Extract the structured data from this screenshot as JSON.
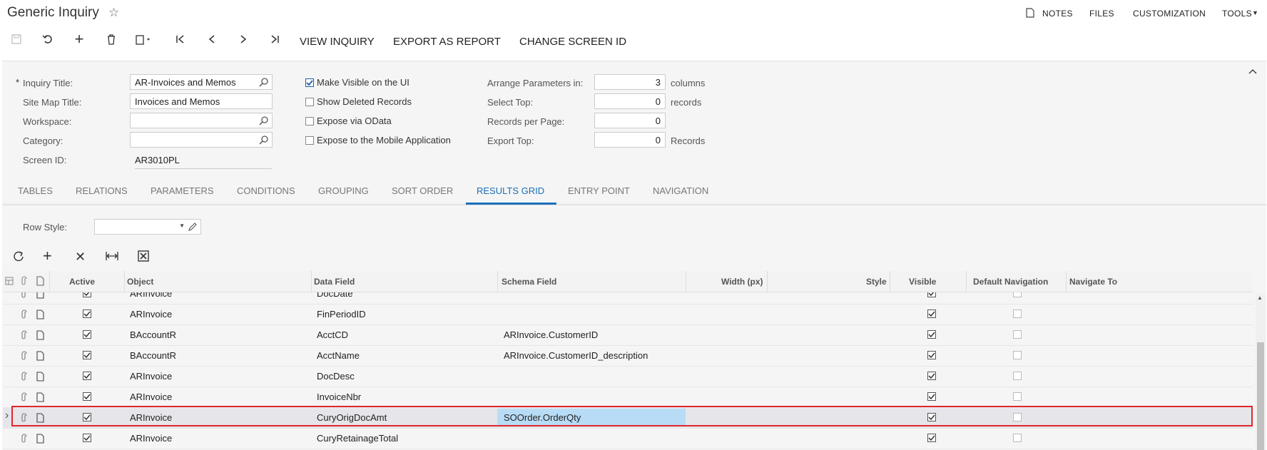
{
  "header": {
    "title": "Generic Inquiry",
    "menu": [
      "NOTES",
      "FILES",
      "CUSTOMIZATION",
      "TOOLS"
    ]
  },
  "toolbar": {
    "view_inquiry": "VIEW INQUIRY",
    "export_as_report": "EXPORT AS REPORT",
    "change_screen_id": "CHANGE SCREEN ID"
  },
  "form": {
    "required_mark": "*",
    "inquiry_title_label": "Inquiry Title:",
    "inquiry_title_value": "AR-Invoices and Memos",
    "site_map_title_label": "Site Map Title:",
    "site_map_title_value": "Invoices and Memos",
    "workspace_label": "Workspace:",
    "workspace_value": "",
    "category_label": "Category:",
    "category_value": "",
    "screen_id_label": "Screen ID:",
    "screen_id_value": "AR3010PL",
    "make_visible_label": "Make Visible on the UI",
    "make_visible_checked": true,
    "show_deleted_label": "Show Deleted Records",
    "show_deleted_checked": false,
    "expose_odata_label": "Expose via OData",
    "expose_odata_checked": false,
    "expose_mobile_label": "Expose to the Mobile Application",
    "expose_mobile_checked": false,
    "arrange_label": "Arrange Parameters in:",
    "arrange_value": "3",
    "arrange_unit": "columns",
    "select_top_label": "Select Top:",
    "select_top_value": "0",
    "select_top_unit": "records",
    "records_per_page_label": "Records per Page:",
    "records_per_page_value": "0",
    "export_top_label": "Export Top:",
    "export_top_value": "0",
    "export_top_unit": "Records"
  },
  "tabs": [
    "TABLES",
    "RELATIONS",
    "PARAMETERS",
    "CONDITIONS",
    "GROUPING",
    "SORT ORDER",
    "RESULTS GRID",
    "ENTRY POINT",
    "NAVIGATION"
  ],
  "active_tab": "RESULTS GRID",
  "results": {
    "row_style_label": "Row Style:",
    "row_style_value": "",
    "columns": {
      "active": "Active",
      "object": "Object",
      "data_field": "Data Field",
      "schema_field": "Schema Field",
      "width": "Width (px)",
      "style": "Style",
      "visible": "Visible",
      "default_navigation": "Default Navigation",
      "navigate_to": "Navigate To"
    },
    "rows": [
      {
        "object": "ARInvoice",
        "data_field": "DocDate",
        "schema_field": "",
        "active": true,
        "visible": true,
        "default_navigation": false
      },
      {
        "object": "ARInvoice",
        "data_field": "FinPeriodID",
        "schema_field": "",
        "active": true,
        "visible": true,
        "default_navigation": false
      },
      {
        "object": "BAccountR",
        "data_field": "AcctCD",
        "schema_field": "ARInvoice.CustomerID",
        "active": true,
        "visible": true,
        "default_navigation": false
      },
      {
        "object": "BAccountR",
        "data_field": "AcctName",
        "schema_field": "ARInvoice.CustomerID_description",
        "active": true,
        "visible": true,
        "default_navigation": false
      },
      {
        "object": "ARInvoice",
        "data_field": "DocDesc",
        "schema_field": "",
        "active": true,
        "visible": true,
        "default_navigation": false
      },
      {
        "object": "ARInvoice",
        "data_field": "InvoiceNbr",
        "schema_field": "",
        "active": true,
        "visible": true,
        "default_navigation": false
      },
      {
        "object": "ARInvoice",
        "data_field": "CuryOrigDocAmt",
        "schema_field": "SOOrder.OrderQty",
        "active": true,
        "visible": true,
        "default_navigation": false,
        "selected": true
      },
      {
        "object": "ARInvoice",
        "data_field": "CuryRetainageTotal",
        "schema_field": "",
        "active": true,
        "visible": true,
        "default_navigation": false
      }
    ]
  },
  "colors": {
    "accent": "#1a6fb8",
    "selection_highlight": "#b8dcf5",
    "selected_row": "#e6e6ea",
    "callout": "#e0262e"
  }
}
